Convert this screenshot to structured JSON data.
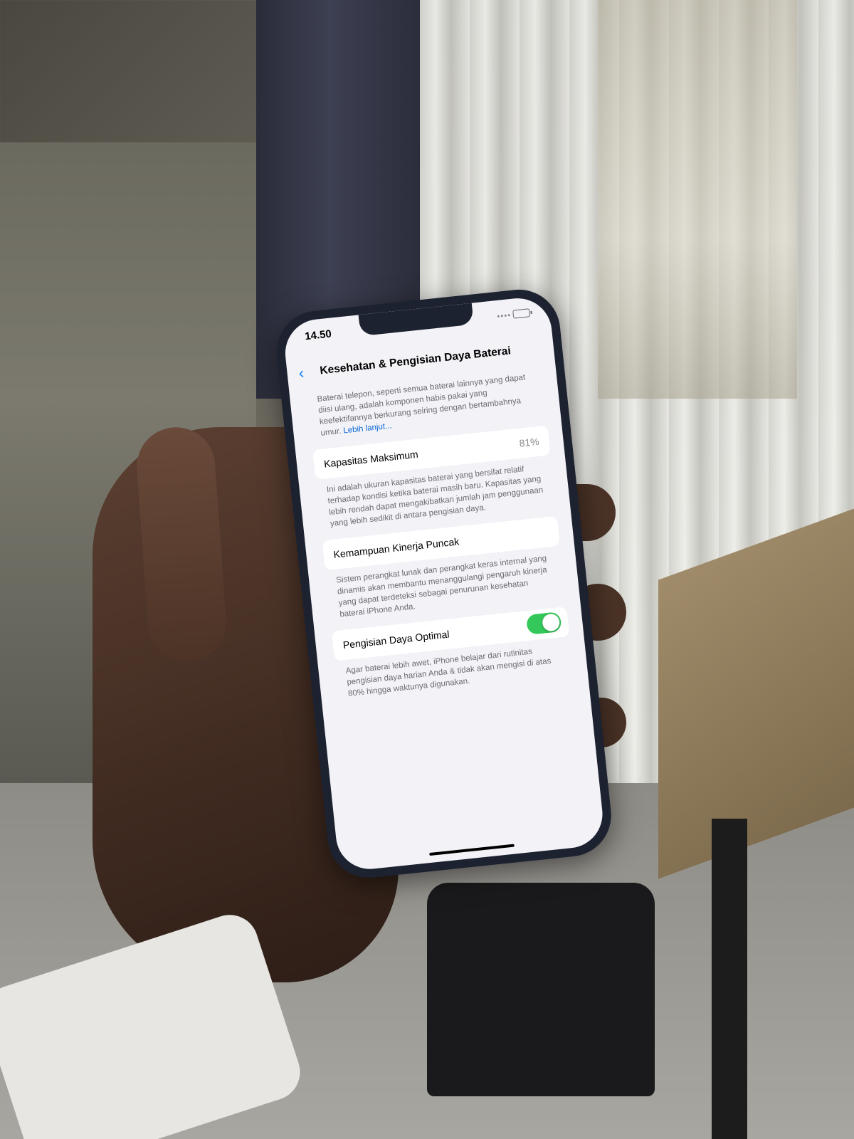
{
  "status": {
    "time": "14.50"
  },
  "nav": {
    "title": "Kesehatan & Pengisian Daya Baterai"
  },
  "intro": {
    "text": "Baterai telepon, seperti semua baterai lainnya yang dapat diisi ulang, adalah komponen habis pakai yang keefektifannya berkurang seiring dengan bertambahnya umur.",
    "link": "Lebih lanjut..."
  },
  "max_capacity": {
    "label": "Kapasitas Maksimum",
    "value": "81%",
    "note": "Ini adalah ukuran kapasitas baterai yang bersifat relatif terhadap kondisi ketika baterai masih baru. Kapasitas yang lebih rendah dapat mengakibatkan jumlah jam penggunaan yang lebih sedikit di antara pengisian daya."
  },
  "peak_performance": {
    "label": "Kemampuan Kinerja Puncak",
    "note": "Sistem perangkat lunak dan perangkat keras internal yang dinamis akan membantu menanggulangi pengaruh kinerja yang dapat terdeteksi sebagai penurunan kesehatan baterai iPhone Anda."
  },
  "optimized_charging": {
    "label": "Pengisian Daya Optimal",
    "enabled": true,
    "note": "Agar baterai lebih awet, iPhone belajar dari rutinitas pengisian daya harian Anda & tidak akan mengisi di atas 80% hingga waktunya digunakan."
  },
  "colors": {
    "accent": "#0a84ff",
    "toggle_on": "#34c759",
    "background": "#f2f2f7"
  }
}
